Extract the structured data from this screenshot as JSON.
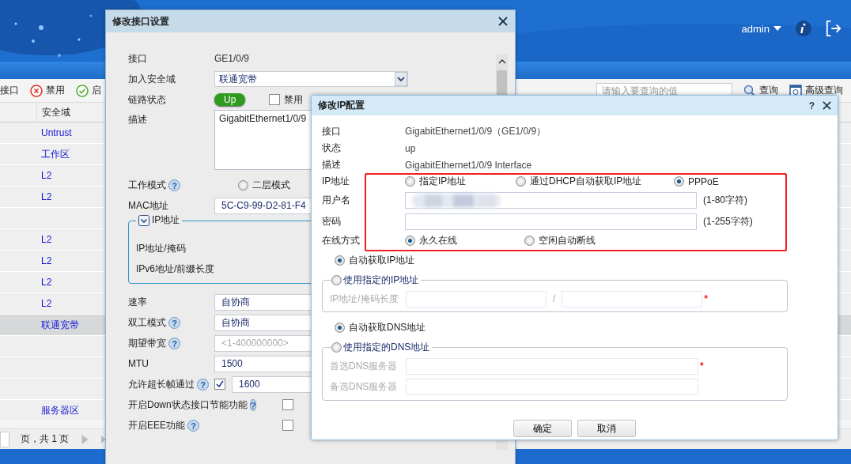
{
  "header": {
    "user": "admin"
  },
  "toolbar": {
    "buttons": [
      {
        "label": "接口",
        "kind": "plain"
      },
      {
        "label": "禁用",
        "kind": "disable"
      },
      {
        "label": "启",
        "kind": "enable"
      }
    ],
    "search": {
      "placeholder": "请输入要查询的值"
    },
    "actions": [
      {
        "label": "查询",
        "kind": "search"
      },
      {
        "label": "高级查询",
        "kind": "advanced"
      }
    ]
  },
  "table": {
    "columns": [
      "安全域"
    ],
    "rows": [
      {
        "zone": "Untrust",
        "selected": false
      },
      {
        "zone": "工作区",
        "selected": false
      },
      {
        "zone": "L2",
        "selected": false
      },
      {
        "zone": "L2",
        "selected": false
      },
      {
        "zone": "",
        "selected": false
      },
      {
        "zone": "L2",
        "selected": false
      },
      {
        "zone": "L2",
        "selected": false
      },
      {
        "zone": "L2",
        "selected": false
      },
      {
        "zone": "L2",
        "selected": false
      },
      {
        "zone": "联通宽带",
        "selected": true
      },
      {
        "zone": "",
        "selected": false
      },
      {
        "zone": "",
        "selected": false
      },
      {
        "zone": "",
        "selected": false
      },
      {
        "zone": "服务器区",
        "selected": false
      }
    ]
  },
  "pager": {
    "text": "页，共 1 页"
  },
  "interface_dialog": {
    "title": "修改接口设置",
    "rows": [
      {
        "kind": "text",
        "label": "接口",
        "value": "GE1/0/9"
      },
      {
        "kind": "select",
        "label": "加入安全域",
        "value": "联通宽带"
      },
      {
        "kind": "status",
        "label": "链路状态",
        "value": "Up",
        "up": true,
        "check_label": "禁用",
        "checked": false
      },
      {
        "kind": "textarea",
        "label": "描述",
        "value": "GigabitEthernet1/0/9"
      },
      {
        "kind": "radio",
        "label": "工作模式",
        "help": "?",
        "option": "二层模式",
        "selected": false
      },
      {
        "kind": "field",
        "label": "MAC地址",
        "value": "5C-C9-99-D2-81-F4"
      },
      {
        "kind": "fieldset",
        "legend": "IP地址",
        "expanded": true,
        "lines": [
          "IP地址/掩码",
          "IPv6地址/前缀长度"
        ]
      },
      {
        "kind": "field",
        "label": "速率",
        "value": "自协商"
      },
      {
        "kind": "field",
        "label": "双工模式",
        "help": "?",
        "value": "自协商"
      },
      {
        "kind": "field",
        "label": "期望带宽",
        "help": "?",
        "placeholder": "<1-400000000>"
      },
      {
        "kind": "field",
        "label": "MTU",
        "value": "1500"
      },
      {
        "kind": "checkfield",
        "label": "允许超长帧通过",
        "help": "?",
        "checked": true,
        "value": "1600"
      },
      {
        "kind": "check",
        "label": "开启Down状态接口节能功能",
        "help": "?",
        "checked": false
      },
      {
        "kind": "check",
        "label": "开启EEE功能",
        "help": "?",
        "checked": false
      }
    ]
  },
  "ip_dialog": {
    "title": "修改IP配置",
    "help": "?",
    "info": [
      {
        "label": "接口",
        "value": "GigabitEthernet1/0/9（GE1/0/9）"
      },
      {
        "label": "状态",
        "value": "up"
      },
      {
        "label": "描述",
        "value": "GigabitEthernet1/0/9 Interface"
      }
    ],
    "ip_mode": {
      "label": "IP地址",
      "options": [
        {
          "label": "指定IP地址",
          "selected": false
        },
        {
          "label": "通过DHCP自动获取IP地址",
          "selected": false
        },
        {
          "label": "PPPoE",
          "selected": true
        }
      ]
    },
    "username": {
      "label": "用户名",
      "hint": "(1-80字符)"
    },
    "password": {
      "label": "密码",
      "hint": "(1-255字符)"
    },
    "online_mode": {
      "label": "在线方式",
      "options": [
        {
          "label": "永久在线",
          "selected": true
        },
        {
          "label": "空闲自动断线",
          "selected": false
        }
      ]
    },
    "ip_auto": {
      "label": "自动获取IP地址",
      "selected": true
    },
    "ip_manual": {
      "label": "使用指定的IP地址",
      "selected": false,
      "field_label": "IP地址/掩码长度",
      "separator": "/",
      "required": "*"
    },
    "dns_auto": {
      "label": "自动获取DNS地址",
      "selected": true
    },
    "dns_manual": {
      "label": "使用指定的DNS地址",
      "selected": false,
      "fields": [
        {
          "label": "首选DNS服务器",
          "required": "*"
        },
        {
          "label": "备选DNS服务器"
        }
      ]
    },
    "buttons": [
      "确定",
      "取消"
    ]
  }
}
